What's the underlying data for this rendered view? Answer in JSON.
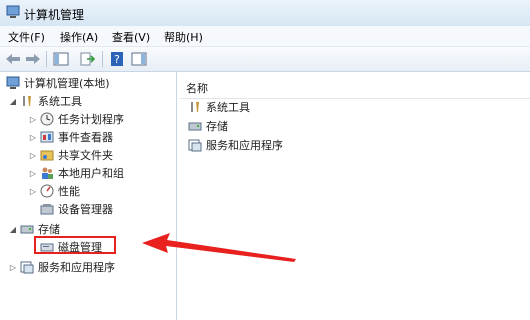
{
  "window": {
    "title": "计算机管理"
  },
  "menu": {
    "file": "文件(F)",
    "action": "操作(A)",
    "view": "查看(V)",
    "help": "帮助(H)"
  },
  "tree": {
    "root": "计算机管理(本地)",
    "system_tools": "系统工具",
    "task_scheduler": "任务计划程序",
    "event_viewer": "事件查看器",
    "shared_folders": "共享文件夹",
    "local_users": "本地用户和组",
    "performance": "性能",
    "device_manager": "设备管理器",
    "storage": "存储",
    "disk_management": "磁盘管理",
    "services_apps": "服务和应用程序"
  },
  "list": {
    "header_name": "名称",
    "items": [
      "系统工具",
      "存储",
      "服务和应用程序"
    ]
  },
  "colors": {
    "annotation": "#e8201e"
  }
}
